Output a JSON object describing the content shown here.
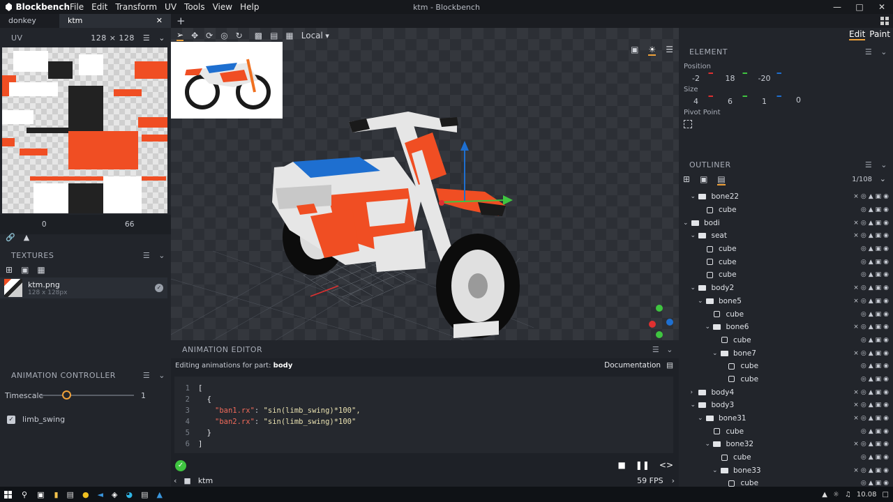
{
  "app": {
    "name": "Blockbench",
    "window_title": "ktm - Blockbench"
  },
  "menu": [
    "File",
    "Edit",
    "Transform",
    "UV",
    "Tools",
    "View",
    "Help"
  ],
  "tabs": [
    {
      "label": "donkey"
    },
    {
      "label": "ktm"
    }
  ],
  "uv": {
    "title": "UV",
    "size_label": "128 × 128",
    "coord_x": "0",
    "coord_y": "66"
  },
  "textures": {
    "title": "TEXTURES",
    "items": [
      {
        "name": "ktm.png",
        "size": "128 x 128px"
      }
    ]
  },
  "anim_controller": {
    "title": "ANIMATION CONTROLLER",
    "timescale_label": "Timescale",
    "timescale_value": "1",
    "timescale_fraction": 0.19,
    "variables": [
      {
        "name": "limb_swing",
        "checked": true
      }
    ]
  },
  "viewport": {
    "space_label": "Local",
    "fps": "59 FPS",
    "file_label": "ktm"
  },
  "mode": {
    "edit": "Edit",
    "paint": "Paint"
  },
  "element": {
    "title": "ELEMENT",
    "position_label": "Position",
    "position": [
      "-2",
      "18",
      "-20"
    ],
    "size_label": "Size",
    "size": [
      "4",
      "6",
      "1",
      "0"
    ],
    "pivot_label": "Pivot Point"
  },
  "outliner": {
    "title": "OUTLINER",
    "count": "1/108",
    "rows": [
      {
        "name": "bone22",
        "depth": 2,
        "type": "group",
        "open": true
      },
      {
        "name": "cube",
        "depth": 3,
        "type": "cube"
      },
      {
        "name": "bodi",
        "depth": 1,
        "type": "group",
        "open": true
      },
      {
        "name": "seat",
        "depth": 2,
        "type": "group",
        "open": true
      },
      {
        "name": "cube",
        "depth": 3,
        "type": "cube"
      },
      {
        "name": "cube",
        "depth": 3,
        "type": "cube"
      },
      {
        "name": "cube",
        "depth": 3,
        "type": "cube"
      },
      {
        "name": "body2",
        "depth": 2,
        "type": "group",
        "open": true
      },
      {
        "name": "bone5",
        "depth": 3,
        "type": "group",
        "open": true
      },
      {
        "name": "cube",
        "depth": 4,
        "type": "cube"
      },
      {
        "name": "bone6",
        "depth": 4,
        "type": "group",
        "open": true
      },
      {
        "name": "cube",
        "depth": 5,
        "type": "cube"
      },
      {
        "name": "bone7",
        "depth": 5,
        "type": "group",
        "open": true
      },
      {
        "name": "cube",
        "depth": 6,
        "type": "cube"
      },
      {
        "name": "cube",
        "depth": 6,
        "type": "cube"
      },
      {
        "name": "body4",
        "depth": 2,
        "type": "group",
        "open": false
      },
      {
        "name": "body3",
        "depth": 2,
        "type": "group",
        "open": true
      },
      {
        "name": "bone31",
        "depth": 3,
        "type": "group",
        "open": true
      },
      {
        "name": "cube",
        "depth": 4,
        "type": "cube"
      },
      {
        "name": "bone32",
        "depth": 4,
        "type": "group",
        "open": true
      },
      {
        "name": "cube",
        "depth": 5,
        "type": "cube"
      },
      {
        "name": "bone33",
        "depth": 5,
        "type": "group",
        "open": true
      },
      {
        "name": "cube",
        "depth": 6,
        "type": "cube"
      }
    ]
  },
  "animation_editor": {
    "title": "ANIMATION EDITOR",
    "editing_prefix": "Editing animations for part: ",
    "part": "body",
    "documentation": "Documentation",
    "code_lines": [
      {
        "n": "1",
        "text": "["
      },
      {
        "n": "2",
        "text": "  {"
      },
      {
        "n": "3",
        "key": "\"ban1.rx\"",
        "val": "\"sin(limb_swing)*100\","
      },
      {
        "n": "4",
        "key": "\"ban2.rx\"",
        "val": "\"sin(limb_swing)*100\""
      },
      {
        "n": "5",
        "text": "  }"
      },
      {
        "n": "6",
        "text": "]"
      }
    ]
  },
  "taskbar": {
    "time": "10.08"
  },
  "colors": {
    "accent": "#f0a23a",
    "orange": "#f04e23",
    "blue": "#1e6fd0"
  }
}
